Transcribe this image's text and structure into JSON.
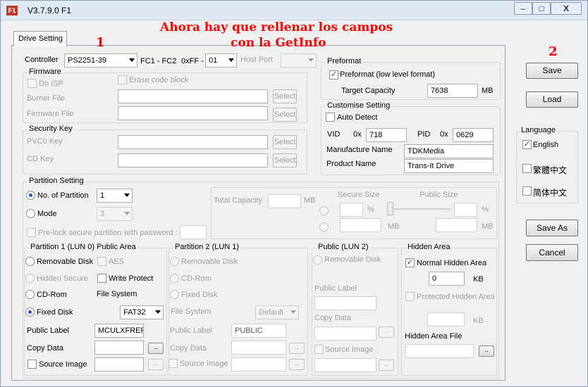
{
  "window": {
    "title": "V3.7.9.0 F1",
    "minimize": "–",
    "maximize": "□",
    "close": "X"
  },
  "tabs": [
    "Drive Setting"
  ],
  "annotations": {
    "step1": "1",
    "step2": "2",
    "line1": "Ahora hay que rellenar los campos",
    "line2": "con la GetInfo",
    "color": "#ff0000"
  },
  "controller": {
    "label": "Controller",
    "value": "PS2251-39",
    "fc_label": "FC1 - FC2",
    "hex_label": "0xFF -",
    "fc_value": "01",
    "host_port_label": "Host Port",
    "host_port_value": ""
  },
  "firmware": {
    "title": "Firmware",
    "do_isp": "Do ISP",
    "erase": "Erase code block",
    "burner_file": "Burner File",
    "firmware_file": "Firmware File",
    "select": "Select"
  },
  "security": {
    "title": "Security Key",
    "pvc0": "PVC0 Key",
    "cd": "CD Key",
    "select": "Select"
  },
  "preformat": {
    "title": "Preformat",
    "check_label": "Preformat (low level format)",
    "checked": true,
    "target_label": "Target Capacity",
    "target_value": "7638",
    "unit": "MB"
  },
  "customise": {
    "title": "Customise Setting",
    "auto_detect": "Auto Detect",
    "vid_label": "VID",
    "hex": "0x",
    "vid": "718",
    "pid_label": "PID",
    "pid": "0629",
    "manufacture_label": "Manufacture Name",
    "manufacture": "TDKMedia",
    "product_label": "Product Name",
    "product": "Trans-It Drive"
  },
  "partition_setting": {
    "title": "Partition Setting",
    "num_label": "No. of Partition",
    "num_value": "1",
    "mode_label": "Mode",
    "mode_value": "3",
    "prelock": "Pre-lock secure partition with password :",
    "total_capacity": "Total Capacity",
    "mb": "MB",
    "secure_size": "Secure Size",
    "public_size": "Public Size",
    "pct": "%"
  },
  "partition1": {
    "title": "Partition 1 (LUN 0) Public Area",
    "removable": "Removable Disk",
    "aes": "AES",
    "hidden_secure": "Hidden Secure",
    "write_protect": "Write Protect",
    "cdrom": "CD-Rom",
    "file_system_label": "File System",
    "fixed": "Fixed Disk",
    "fs_value": "FAT32",
    "public_label": "Public Label",
    "label_value": "MCULXFRER",
    "copy_data": "Copy Data",
    "source_image": "Source Image",
    "browse": ".."
  },
  "partition2": {
    "title": "Partition 2 (LUN 1)",
    "removable": "Removable Disk",
    "cdrom": "CD-Rom",
    "fixed": "Fixed Disk",
    "file_system_label": "File System",
    "fs_value": "Default",
    "public_label": "Public Label",
    "label_value": "PUBLIC",
    "copy_data": "Copy Data",
    "source_image": "Source Image",
    "browse": ".."
  },
  "public_lun2": {
    "title": "Public (LUN 2)",
    "removable": "Removable Disk",
    "public_label": "Public Label",
    "copy_data": "Copy Data",
    "source_image": "Source Image",
    "browse": ".."
  },
  "hidden_area": {
    "title": "Hidden Area",
    "normal": "Normal Hidden Area",
    "normal_value": "0",
    "kb": "KB",
    "protected": "Protected Hidden Area",
    "file_label": "Hidden Area File",
    "browse": ".."
  },
  "side_buttons": {
    "save": "Save",
    "load": "Load",
    "save_as": "Save As",
    "cancel": "Cancel"
  },
  "language": {
    "title": "Language",
    "english": "English",
    "trad_chinese": "繁體中文",
    "simp_chinese": "简体中文"
  }
}
